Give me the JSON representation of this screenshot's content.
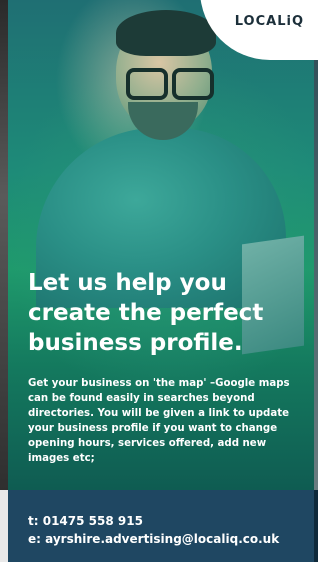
{
  "logo": {
    "text": "LOCALiQ"
  },
  "headline": "Let us help you create the perfect business profile.",
  "body": "Get your business on 'the map' –Google maps can be found easily in searches beyond directories. You will be given a link to update your business profile if you want to change opening hours, services offered, add new images etc;",
  "contact": {
    "phone": "t: 01475 558 915",
    "email": "e: ayrshire.advertising@localiq.co.uk"
  },
  "colors": {
    "footer": "#1f4762",
    "green": "#1f9a6c",
    "teal": "#1f6f73"
  }
}
